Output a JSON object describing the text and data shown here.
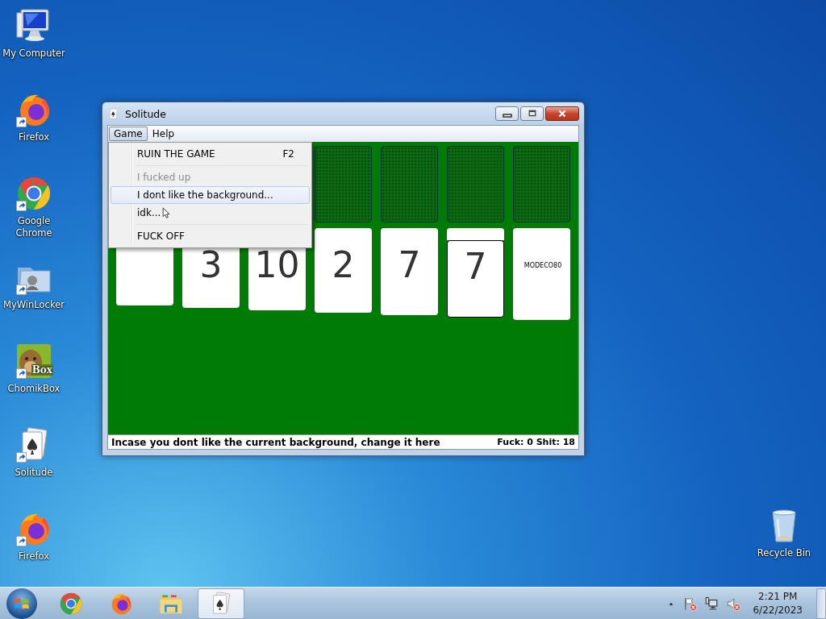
{
  "desktop_icons": [
    {
      "label": "My Computer",
      "kind": "computer",
      "shortcut": false
    },
    {
      "label": "Firefox",
      "kind": "firefox",
      "shortcut": true
    },
    {
      "label": "Google Chrome",
      "kind": "chrome",
      "shortcut": true
    },
    {
      "label": "MyWinLocker",
      "kind": "folder",
      "shortcut": true
    },
    {
      "label": "ChomikBox",
      "kind": "hamster",
      "shortcut": true,
      "badge": "Box"
    },
    {
      "label": "Solitude",
      "kind": "cards",
      "shortcut": true
    },
    {
      "label": "Firefox",
      "kind": "firefox",
      "shortcut": true
    }
  ],
  "recycle_bin": {
    "label": "Recycle Bin"
  },
  "window": {
    "title": "Solitude",
    "menus": [
      {
        "label": "Game",
        "selected": true
      },
      {
        "label": "Help",
        "selected": false
      }
    ],
    "game_menu": [
      {
        "kind": "item",
        "label": "RUIN THE GAME",
        "shortcut": "F2",
        "disabled": false,
        "selected": false
      },
      {
        "kind": "separator"
      },
      {
        "kind": "item",
        "label": "I fucked up",
        "disabled": true,
        "selected": false
      },
      {
        "kind": "item",
        "label": "I dont like the background...",
        "disabled": false,
        "selected": true
      },
      {
        "kind": "item",
        "label": "idk...",
        "disabled": false,
        "selected": false
      },
      {
        "kind": "separator"
      },
      {
        "kind": "item",
        "label": "FUCK OFF",
        "disabled": false,
        "selected": false
      }
    ],
    "foundations": [
      {
        "kind": "empty"
      },
      {
        "kind": "empty"
      },
      {
        "kind": "empty"
      },
      {
        "kind": "empty"
      }
    ],
    "tableau": [
      {
        "kind": "blank",
        "selected": false
      },
      {
        "kind": "number",
        "label": "3",
        "selected": false
      },
      {
        "kind": "number",
        "label": "10",
        "selected": false
      },
      {
        "kind": "number",
        "label": "2",
        "selected": false
      },
      {
        "kind": "number",
        "label": "7",
        "selected": false
      },
      {
        "kind": "number",
        "label": "7",
        "selected": true
      },
      {
        "kind": "text",
        "label": "MODECO80",
        "selected": false
      }
    ],
    "status_bar": {
      "message": "Incase you dont like the current background, change it here",
      "score": "Fuck: 0 Shit: 18"
    }
  },
  "taskbar": {
    "apps": [
      {
        "kind": "chrome",
        "selected": false
      },
      {
        "kind": "firefox",
        "selected": false
      },
      {
        "kind": "explorer",
        "selected": false
      },
      {
        "kind": "cards",
        "selected": true
      }
    ],
    "tray": [
      {
        "kind": "flag"
      },
      {
        "kind": "network"
      },
      {
        "kind": "speaker"
      }
    ],
    "clock": {
      "time": "2:21 PM",
      "date": "6/22/2023"
    }
  }
}
